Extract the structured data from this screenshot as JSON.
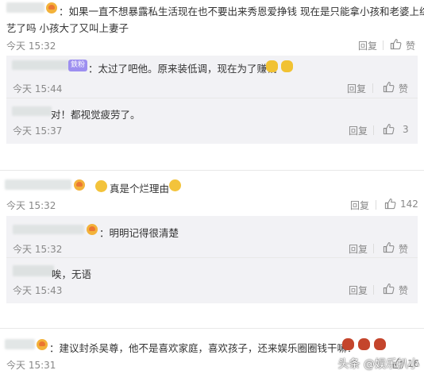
{
  "comments": [
    {
      "text_line1": "：如果一直不想暴露私生活现在也不要出来秀恩爱挣钱 现在是只能拿小孩和老婆上综",
      "text_line2": "艺了吗 小孩大了又叫上妻子",
      "time": "今天 15:32",
      "reply_label": "回复",
      "like_label": "赞",
      "replies": [
        {
          "fan_badge": "鉄粉",
          "text": "：太过了吧他。原来装低调，现在为了赚钱",
          "time": "今天 15:44",
          "reply_label": "回复",
          "like_label": "赞"
        },
        {
          "text": "对！都视觉疲劳了。",
          "time": "今天 15:37",
          "reply_label": "回复",
          "like_count": "3"
        }
      ]
    },
    {
      "text": "真是个烂理由",
      "time": "今天 15:32",
      "reply_label": "回复",
      "like_count": "142",
      "replies": [
        {
          "text": "：明明记得很清楚",
          "time": "今天 15:32",
          "reply_label": "回复",
          "like_label": "赞"
        },
        {
          "text": "唉，无语",
          "time": "今天 15:43",
          "reply_label": "回复",
          "like_label": "赞"
        }
      ]
    },
    {
      "text": "：建议封杀吴尊，他不是喜欢家庭，喜欢孩子，还来娱乐圈圈钱干嘛？",
      "time": "今天 15:31",
      "reply_label": "回复",
      "like_count": "16"
    }
  ],
  "watermark": "头条 @娱乐扒小"
}
